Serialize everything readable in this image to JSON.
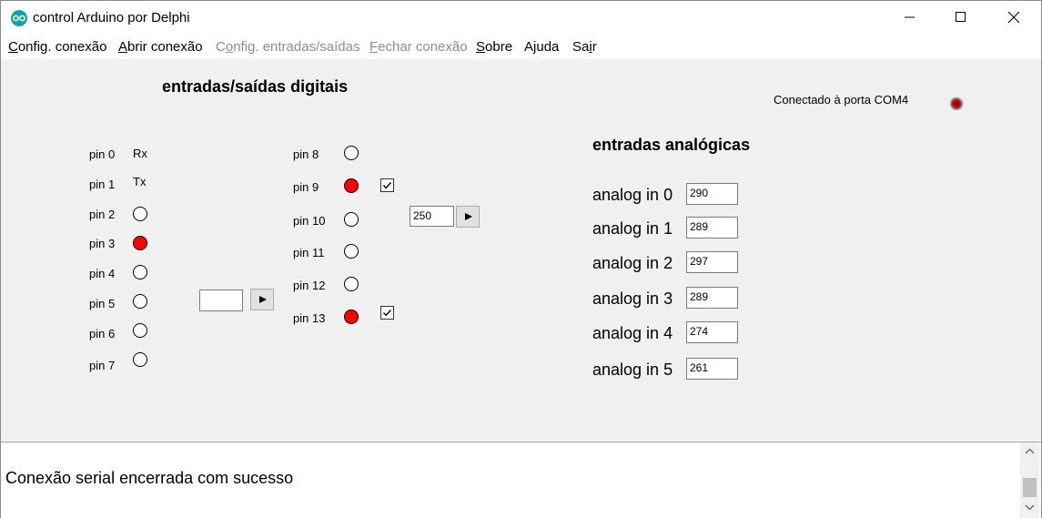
{
  "window": {
    "title": "control Arduino por Delphi"
  },
  "menu": {
    "items": [
      {
        "pre": "",
        "u": "C",
        "post": "onfig. conexão",
        "enabled": true
      },
      {
        "pre": "",
        "u": "A",
        "post": "brir conexão",
        "enabled": true
      },
      {
        "pre": "C",
        "u": "o",
        "post": "nfig. entradas/saídas",
        "enabled": false
      },
      {
        "pre": "",
        "u": "F",
        "post": "echar conexão",
        "enabled": false
      },
      {
        "pre": "",
        "u": "S",
        "post": "obre",
        "enabled": true
      },
      {
        "pre": "A",
        "u": "j",
        "post": "uda",
        "enabled": true
      },
      {
        "pre": "Sa",
        "u": "i",
        "post": "r",
        "enabled": true
      }
    ]
  },
  "digital": {
    "heading": "entradas/saídas digitais",
    "left_pins": [
      {
        "label": "pin 0",
        "special": "Rx"
      },
      {
        "label": "pin 1",
        "special": "Tx"
      },
      {
        "label": "pin 2",
        "state": "off"
      },
      {
        "label": "pin 3",
        "state": "on"
      },
      {
        "label": "pin 4",
        "state": "off"
      },
      {
        "label": "pin 5",
        "state": "off"
      },
      {
        "label": "pin 6",
        "state": "off"
      },
      {
        "label": "pin 7",
        "state": "off"
      }
    ],
    "right_pins": [
      {
        "label": "pin 8",
        "state": "off",
        "checkbox": false
      },
      {
        "label": "pin 9",
        "state": "on",
        "checkbox": true,
        "checked": true
      },
      {
        "label": "pin 10",
        "state": "off",
        "checkbox": false
      },
      {
        "label": "pin 11",
        "state": "off",
        "checkbox": false
      },
      {
        "label": "pin 12",
        "state": "off",
        "checkbox": false
      },
      {
        "label": "pin 13",
        "state": "on",
        "checkbox": true,
        "checked": true
      }
    ],
    "digital_value_input": "",
    "pwm_value_input": "250"
  },
  "analog": {
    "heading": "entradas analógicas",
    "inputs": [
      {
        "label": "analog in 0",
        "value": "290"
      },
      {
        "label": "analog in 1",
        "value": "289"
      },
      {
        "label": "analog in 2",
        "value": "297"
      },
      {
        "label": "analog in 3",
        "value": "289"
      },
      {
        "label": "analog in 4",
        "value": "274"
      },
      {
        "label": "analog in 5",
        "value": "261"
      }
    ]
  },
  "status": {
    "text": "Conectado à porta COM4",
    "led_color": "#cc0000"
  },
  "log": {
    "text": "Conexão serial encerrada com sucesso"
  },
  "colors": {
    "led_on": "#ff0000",
    "panel_bg": "#f0f0f0",
    "accent_icon": "#16a3a7"
  }
}
